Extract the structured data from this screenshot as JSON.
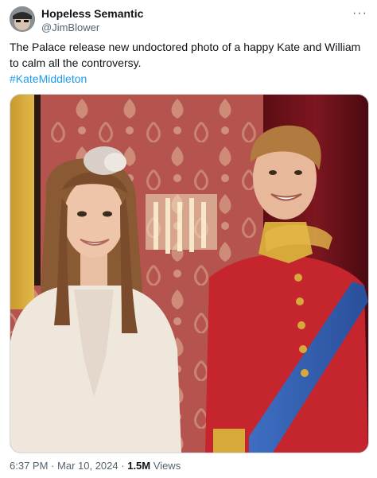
{
  "author": {
    "display_name": "Hopeless Semantic",
    "handle": "@JimBlower"
  },
  "tweet": {
    "text": "The Palace release new undoctored photo of a happy Kate and William to calm all the controversy.",
    "hashtag": "#KateMiddleton"
  },
  "menu_icon": "more-horizontal-icon",
  "meta": {
    "time": "6:37 PM",
    "separator": "·",
    "date": "Mar 10, 2024",
    "views_count": "1.5M",
    "views_label": "Views"
  },
  "colors": {
    "link": "#1d9bf0",
    "secondary_text": "#536471",
    "primary_text": "#0f1419"
  }
}
